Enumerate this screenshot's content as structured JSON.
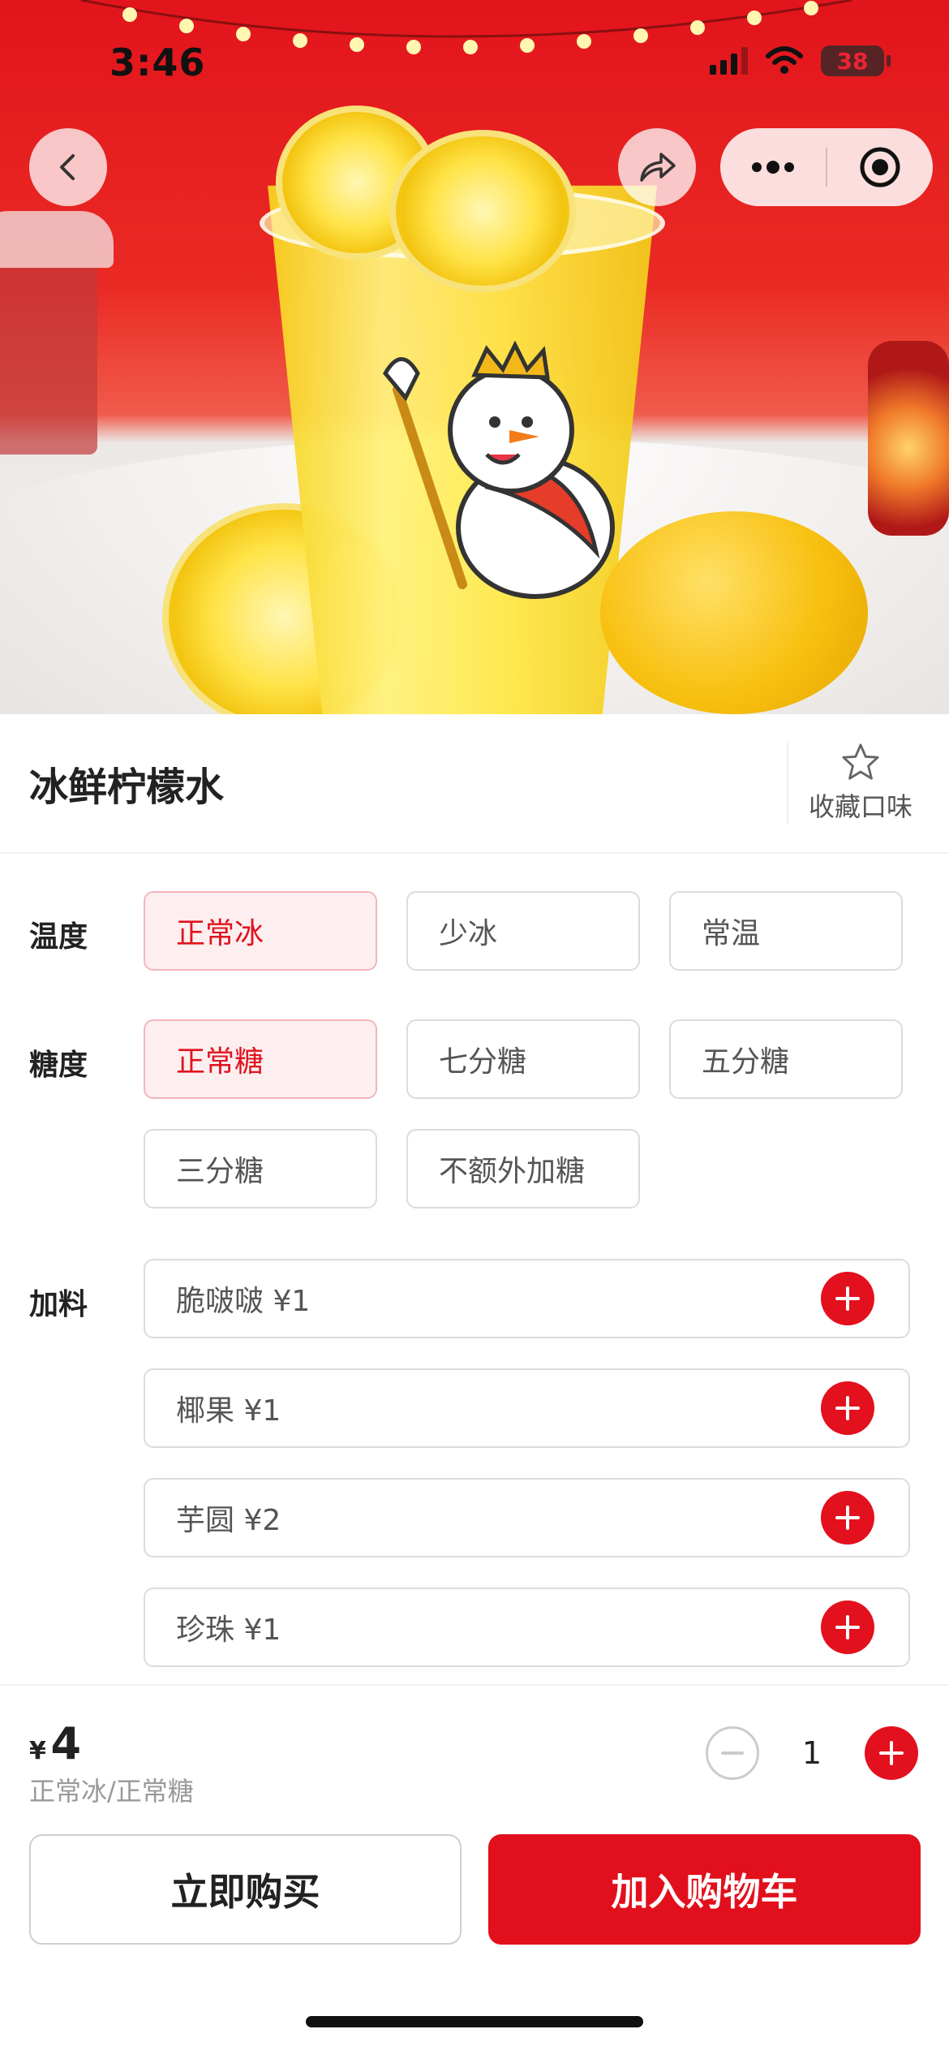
{
  "status_bar": {
    "time": "3:46",
    "battery": "38"
  },
  "product": {
    "name": "冰鲜柠檬水",
    "favorite_label": "收藏口味"
  },
  "options": {
    "temperature": {
      "label": "温度",
      "choices": [
        "正常冰",
        "少冰",
        "常温"
      ],
      "selected": "正常冰"
    },
    "sugar": {
      "label": "糖度",
      "choices": [
        "正常糖",
        "七分糖",
        "五分糖",
        "三分糖",
        "不额外加糖"
      ],
      "selected": "正常糖"
    },
    "toppings": {
      "label": "加料",
      "items": [
        "脆啵啵 ¥1",
        "椰果 ¥1",
        "芋圆 ¥2",
        "珍珠 ¥1"
      ]
    }
  },
  "footer": {
    "currency": "¥",
    "price": "4",
    "selection_summary": "正常冰/正常糖",
    "quantity": "1",
    "buy_now_label": "立即购买",
    "add_to_cart_label": "加入购物车"
  },
  "colors": {
    "accent": "#e2101c",
    "active_bg": "#fdeff0"
  }
}
